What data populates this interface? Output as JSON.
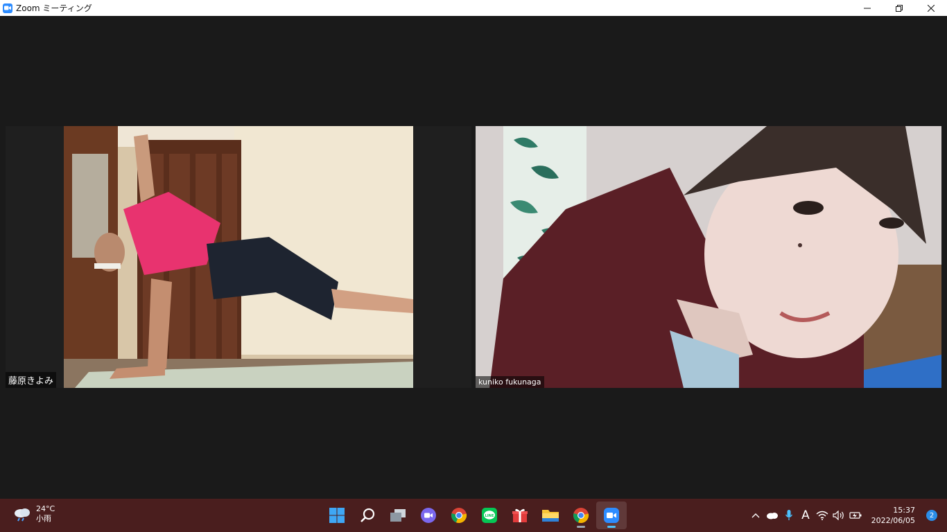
{
  "window": {
    "title": "Zoom ミーティング",
    "minimize": "—",
    "restore": "❐",
    "close": "✕"
  },
  "participants": [
    {
      "name": "藤原きよみ"
    },
    {
      "name": "kuniko fukunaga"
    }
  ],
  "taskbar": {
    "weather": {
      "temp": "24°C",
      "condition": "小雨"
    },
    "apps": [
      {
        "id": "start",
        "icon": "windows-start-icon"
      },
      {
        "id": "search",
        "icon": "search-icon"
      },
      {
        "id": "task-view",
        "icon": "task-view-icon"
      },
      {
        "id": "teams-chat",
        "icon": "chat-camera-icon"
      },
      {
        "id": "chrome-1",
        "icon": "chrome-icon"
      },
      {
        "id": "line",
        "icon": "line-icon",
        "label": "LINE"
      },
      {
        "id": "gift",
        "icon": "gift-icon"
      },
      {
        "id": "explorer",
        "icon": "folder-icon"
      },
      {
        "id": "chrome-2",
        "icon": "chrome-icon"
      },
      {
        "id": "zoom",
        "icon": "zoom-icon"
      }
    ],
    "tray": {
      "ime": "A",
      "time": "15:37",
      "date": "2022/06/05",
      "notifications": "2"
    }
  },
  "colors": {
    "taskbar": "#4a1e1e",
    "meeting_bg": "#1a1a1a",
    "accent": "#2d8cff"
  }
}
